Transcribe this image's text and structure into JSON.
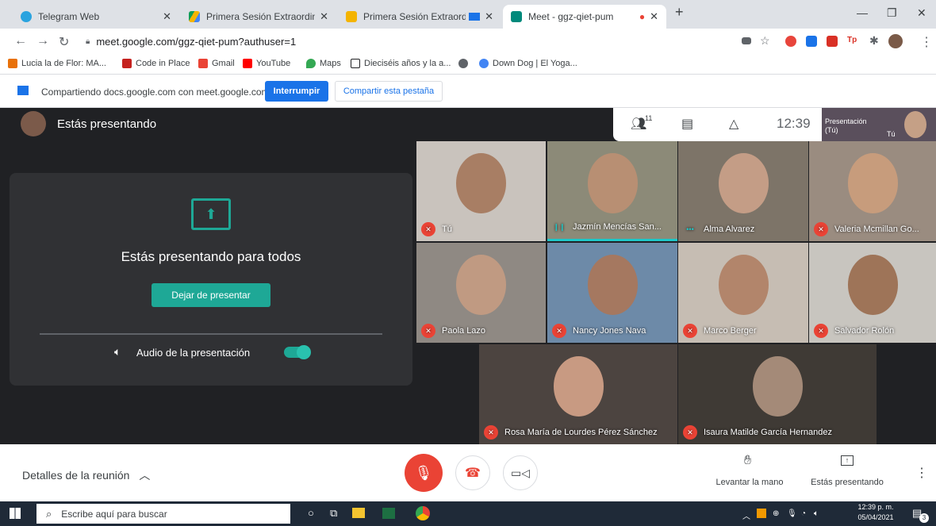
{
  "browser": {
    "tabs": [
      {
        "title": "Telegram Web",
        "color": "#2AA3DF"
      },
      {
        "title": "Primera Sesión Extraordinaria - G",
        "color": "#F4B400"
      },
      {
        "title": "Primera Sesión Extraordinari",
        "color": "#F4B400"
      },
      {
        "title": "Meet - ggz-qiet-pum",
        "color": "#00897B"
      }
    ],
    "new_tab": "+",
    "url": "meet.google.com/ggz-qiet-pum?authuser=1",
    "bookmarks": [
      {
        "label": "Lucia la de Flor: MA...",
        "color": "#E8710A"
      },
      {
        "label": "Code in Place",
        "color": "#C5221F"
      },
      {
        "label": "Gmail",
        "color": "#EA4335"
      },
      {
        "label": "YouTube",
        "color": "#FF0000"
      },
      {
        "label": "Maps",
        "color": "#34A853"
      },
      {
        "label": "Dieciséis años y la a...",
        "color": "#202124"
      },
      {
        "label": "Down Dog | El Yoga...",
        "color": "#4285F4"
      }
    ]
  },
  "sharing": {
    "text": "Compartiendo docs.google.com con meet.google.com",
    "stop_label": "Interrumpir",
    "share_tab_label": "Compartir esta pestaña"
  },
  "meet": {
    "header": "Estás presentando",
    "panel_title": "Estás presentando para todos",
    "stop_presenting": "Dejar de presentar",
    "audio_label": "Audio de la presentación",
    "audio_on": true,
    "participant_count": "11",
    "time": "12:39",
    "self_preview_label": "Presentación (Tú)",
    "self_preview_name": "Tú",
    "participants": [
      {
        "name": "Tú",
        "muted": true,
        "bg": "#c9c3bd",
        "face": "#a87e64"
      },
      {
        "name": "Jazmín Mencías San...",
        "muted": false,
        "speaking": true,
        "bg": "#8c8a78",
        "face": "#b88f73"
      },
      {
        "name": "Alma Alvarez",
        "muted": false,
        "bg": "#7d7468",
        "face": "#c49d86"
      },
      {
        "name": "Valeria Mcmillan Go...",
        "muted": true,
        "bg": "#9a8c80",
        "face": "#c79c7c"
      },
      {
        "name": "Paola Lazo",
        "muted": true,
        "bg": "#8f8983",
        "face": "#c09a82"
      },
      {
        "name": "Nancy Jones Nava",
        "muted": true,
        "bg": "#6d8aa8",
        "face": "#a57860"
      },
      {
        "name": "Marco Berger",
        "muted": true,
        "bg": "#c6bdb3",
        "face": "#b2856b"
      },
      {
        "name": "Salvador Rolón",
        "muted": true,
        "bg": "#c8c5bf",
        "face": "#9e7458"
      },
      {
        "name": "Rosa María de Lourdes Pérez Sánchez",
        "muted": true,
        "bg": "#4c4440",
        "face": "#c89a82"
      },
      {
        "name": "Isaura Matilde García Hernandez",
        "muted": true,
        "bg": "#3f3a35",
        "face": "#a48a78"
      }
    ]
  },
  "bottom": {
    "details": "Detalles de la reunión",
    "raise_hand": "Levantar la mano",
    "presenting": "Estás presentando"
  },
  "taskbar": {
    "search_placeholder": "Escribe aquí para buscar",
    "time": "12:39 p. m.",
    "date": "05/04/2021",
    "notif_count": "3"
  }
}
